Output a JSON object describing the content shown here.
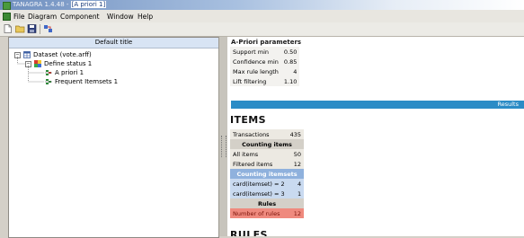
{
  "window": {
    "title_prefix": "TANAGRA 1.4.48 - ",
    "title_doc": "[A priori 1]"
  },
  "menu": {
    "items": [
      "File",
      "Diagram",
      "Component",
      "Window",
      "Help"
    ]
  },
  "toolbar": {
    "buttons": [
      "new-icon",
      "open-icon",
      "save-icon",
      "connect-icon"
    ]
  },
  "left_pane": {
    "header": "Default title",
    "tree": [
      {
        "label": "Dataset (vote.arff)",
        "icon": "table-icon"
      },
      {
        "label": "Define status 1",
        "icon": "define-status-icon"
      },
      {
        "label": "A priori 1",
        "icon": "apriori-icon"
      },
      {
        "label": "Frequent Itemsets 1",
        "icon": "frequent-itemsets-icon"
      }
    ]
  },
  "params": {
    "title": "A-Priori parameters",
    "rows": [
      {
        "label": "Support min",
        "value": "0.50"
      },
      {
        "label": "Confidence min",
        "value": "0.85"
      },
      {
        "label": "Max rule length",
        "value": "4"
      },
      {
        "label": "Lift filtering",
        "value": "1.10"
      }
    ]
  },
  "results": {
    "label": "Results"
  },
  "items": {
    "heading": "ITEMS",
    "transactions": {
      "label": "Transactions",
      "value": "435"
    },
    "counting_items": {
      "header": "Counting items",
      "rows": [
        {
          "label": "All items",
          "value": "50"
        },
        {
          "label": "Filtered items",
          "value": "12"
        }
      ]
    },
    "counting_itemsets": {
      "header": "Counting itemsets",
      "rows": [
        {
          "label": "card(itemset) = 2",
          "value": "4"
        },
        {
          "label": "card(itemset) = 3",
          "value": "1"
        }
      ]
    },
    "rules": {
      "header": "Rules",
      "row": {
        "label": "Number of rules",
        "value": "12"
      }
    }
  },
  "rules_heading": "RULES",
  "colors": {
    "results_bar": "#2b8cc6",
    "itemsets_header": "#8fb1dd",
    "itemsets_rows": "#c9daf0",
    "rules_row": "#ef8a7e",
    "table_shade": "#d4d0c8",
    "table_light": "#ece9e2"
  }
}
